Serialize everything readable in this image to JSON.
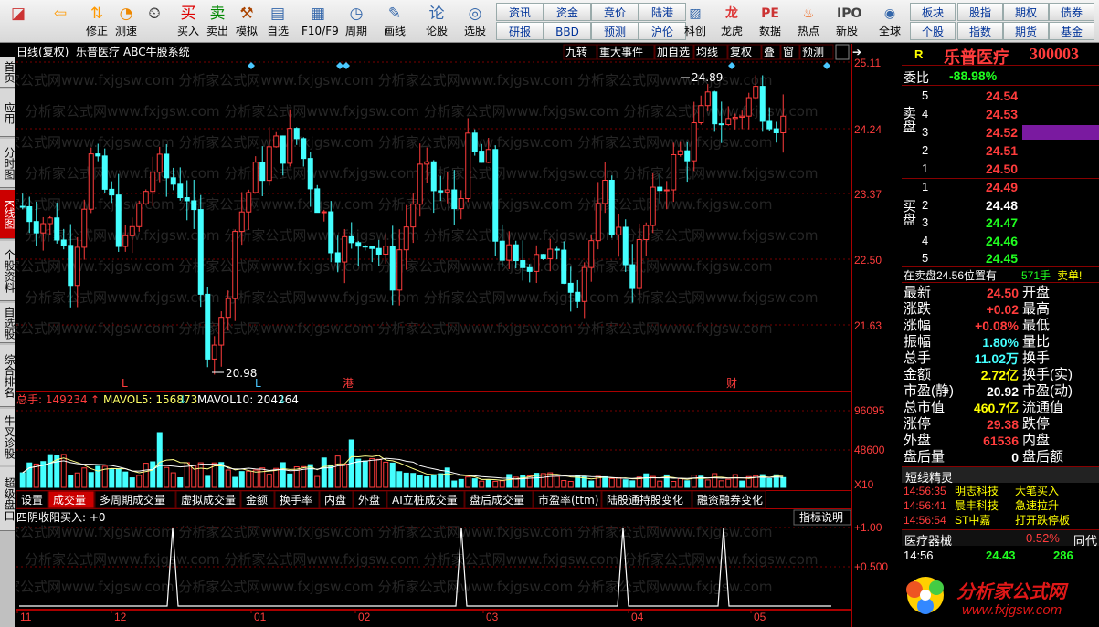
{
  "toolbar": {
    "buttons": [
      {
        "id": "home",
        "label": "",
        "icon": "◪"
      },
      {
        "id": "back",
        "label": "",
        "icon": "⇦"
      },
      {
        "id": "fix",
        "label": "修正",
        "icon": "⇅"
      },
      {
        "id": "test",
        "label": "测速",
        "icon": "◔"
      },
      {
        "id": "alarm",
        "label": "",
        "icon": "⏲"
      },
      {
        "id": "buy",
        "label": "买入",
        "icon": "买"
      },
      {
        "id": "sell",
        "label": "卖出",
        "icon": "卖"
      },
      {
        "id": "sim",
        "label": "模拟",
        "icon": "⚒"
      },
      {
        "id": "self",
        "label": "自选",
        "icon": "▤"
      },
      {
        "id": "f10",
        "label": "F10/F9",
        "icon": "▦"
      },
      {
        "id": "period",
        "label": "周期",
        "icon": "◷"
      },
      {
        "id": "draw",
        "label": "画线",
        "icon": "✎"
      },
      {
        "id": "lungu",
        "label": "论股",
        "icon": "论"
      },
      {
        "id": "pick",
        "label": "选股",
        "icon": "◎"
      }
    ],
    "small": [
      [
        "资讯",
        "资金",
        "竞价",
        "陆港"
      ],
      [
        "研报",
        "BBD",
        "预测",
        "沪伦"
      ]
    ],
    "buttons2": [
      {
        "id": "kechuang",
        "label": "科创",
        "icon": "▨"
      },
      {
        "id": "longhu",
        "label": "龙虎",
        "icon": "龙"
      },
      {
        "id": "shuju",
        "label": "数据",
        "icon": "PE"
      },
      {
        "id": "redian",
        "label": "热点",
        "icon": "♨"
      },
      {
        "id": "xingu",
        "label": "新股",
        "icon": "IPO"
      },
      {
        "id": "global",
        "label": "全球",
        "icon": "◉"
      }
    ],
    "small2": [
      [
        "板块",
        "股指",
        "期权",
        "债券"
      ],
      [
        "个股",
        "指数",
        "期货",
        "基金"
      ]
    ]
  },
  "left_tabs": [
    "首页",
    "应用",
    "分时图",
    "K线图",
    "个股资料",
    "自选股",
    "综合排名",
    "牛叉诊股",
    "超级盘口"
  ],
  "chart": {
    "title": "日线(复权)",
    "stock": "乐普医疗",
    "system": "ABC牛股系统",
    "buttons": [
      "九转",
      "重大事件",
      "加自选",
      "均线",
      "复权",
      "叠",
      "窗",
      "预测"
    ],
    "price_ticks": [
      "25.11",
      "24.24",
      "23.37",
      "22.50",
      "21.63"
    ],
    "high_label": "24.89",
    "low_label": "20.98",
    "event_marks": [
      "L",
      "L",
      "港",
      "财"
    ],
    "vol_label": "总手: 149234",
    "mavol5": "MAVOL5: 156873",
    "mavol10": "MAVOL10: 204264",
    "vol_ticks": [
      "96095",
      "48600",
      "X10"
    ],
    "tabs": [
      "设置",
      "成交量",
      "多周期成交量",
      "虚拟成交量",
      "金额",
      "换手率",
      "内盘",
      "外盘",
      "AI立桩成交量",
      "盘后成交量",
      "市盈率(ttm)",
      "陆股通持股变化",
      "融资融券变化"
    ],
    "indicator": "四阴收阳买入: +0",
    "indicator_help": "指标说明",
    "ind_ticks": [
      "+1.00",
      "+0.500"
    ],
    "months": [
      "11",
      "12",
      "01",
      "02",
      "03",
      "04",
      "05"
    ],
    "watermark": "分析家公式网www.fxjgsw.com"
  },
  "quote": {
    "name": "乐普医疗",
    "code": "300003",
    "r": "R",
    "weibi_label": "委比",
    "weibi": "-88.98%",
    "sell_label": "卖盘",
    "buy_label": "买盘",
    "asks": [
      [
        "5",
        "24.54"
      ],
      [
        "4",
        "24.53"
      ],
      [
        "3",
        "24.52"
      ],
      [
        "2",
        "24.51"
      ],
      [
        "1",
        "24.50"
      ]
    ],
    "bids": [
      [
        "1",
        "24.49"
      ],
      [
        "2",
        "24.48"
      ],
      [
        "3",
        "24.47"
      ],
      [
        "4",
        "24.46"
      ],
      [
        "5",
        "24.45"
      ]
    ],
    "alert": "在卖盘24.56位置有",
    "alert_vol": "571手",
    "alert_tail": "卖单!",
    "stats": [
      [
        "最新",
        "24.50",
        "开盘"
      ],
      [
        "涨跌",
        "+0.02",
        "最高"
      ],
      [
        "涨幅",
        "+0.08%",
        "最低"
      ],
      [
        "振幅",
        "1.80%",
        "量比"
      ],
      [
        "总手",
        "11.02万",
        "换手"
      ],
      [
        "金额",
        "2.72亿",
        "换手(实)"
      ],
      [
        "市盈(静)",
        "20.92",
        "市盈(动)"
      ],
      [
        "总市值",
        "460.7亿",
        "流通值"
      ],
      [
        "涨停",
        "29.38",
        "跌停"
      ],
      [
        "外盘",
        "61536",
        "内盘"
      ],
      [
        "盘后量",
        "0",
        "盘后额"
      ]
    ],
    "short_title": "短线精灵",
    "short": [
      [
        "14:56:35",
        "明志科技",
        "大笔买入"
      ],
      [
        "14:56:41",
        "晨丰科技",
        "急速拉升"
      ],
      [
        "14:56:54",
        "ST中嘉",
        "打开跌停板"
      ]
    ],
    "sector": "医疗器械",
    "sector_pct": "0.52%",
    "sector_tail": "同代",
    "ticks": [
      [
        "14:56",
        "24.43",
        "286"
      ],
      [
        "14:56",
        "24.50",
        ""
      ]
    ],
    "banner_text": "分析家公式网",
    "banner_url": "www.fxjgsw.com"
  }
}
